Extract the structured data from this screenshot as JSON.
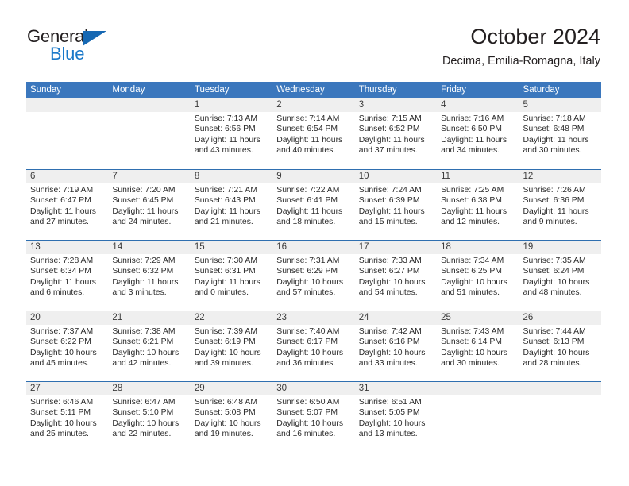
{
  "brand": {
    "name_part1": "General",
    "name_part2": "Blue",
    "triangle_color": "#1668b3",
    "blue_color": "#1b79c9"
  },
  "header": {
    "title": "October 2024",
    "location": "Decima, Emilia-Romagna, Italy",
    "accent_color": "#3b77bd",
    "band_color": "#efefef"
  },
  "weekdays": [
    "Sunday",
    "Monday",
    "Tuesday",
    "Wednesday",
    "Thursday",
    "Friday",
    "Saturday"
  ],
  "weeks": [
    [
      {
        "day": "",
        "lines": []
      },
      {
        "day": "",
        "lines": []
      },
      {
        "day": "1",
        "lines": [
          "Sunrise: 7:13 AM",
          "Sunset: 6:56 PM",
          "Daylight: 11 hours",
          "and 43 minutes."
        ]
      },
      {
        "day": "2",
        "lines": [
          "Sunrise: 7:14 AM",
          "Sunset: 6:54 PM",
          "Daylight: 11 hours",
          "and 40 minutes."
        ]
      },
      {
        "day": "3",
        "lines": [
          "Sunrise: 7:15 AM",
          "Sunset: 6:52 PM",
          "Daylight: 11 hours",
          "and 37 minutes."
        ]
      },
      {
        "day": "4",
        "lines": [
          "Sunrise: 7:16 AM",
          "Sunset: 6:50 PM",
          "Daylight: 11 hours",
          "and 34 minutes."
        ]
      },
      {
        "day": "5",
        "lines": [
          "Sunrise: 7:18 AM",
          "Sunset: 6:48 PM",
          "Daylight: 11 hours",
          "and 30 minutes."
        ]
      }
    ],
    [
      {
        "day": "6",
        "lines": [
          "Sunrise: 7:19 AM",
          "Sunset: 6:47 PM",
          "Daylight: 11 hours",
          "and 27 minutes."
        ]
      },
      {
        "day": "7",
        "lines": [
          "Sunrise: 7:20 AM",
          "Sunset: 6:45 PM",
          "Daylight: 11 hours",
          "and 24 minutes."
        ]
      },
      {
        "day": "8",
        "lines": [
          "Sunrise: 7:21 AM",
          "Sunset: 6:43 PM",
          "Daylight: 11 hours",
          "and 21 minutes."
        ]
      },
      {
        "day": "9",
        "lines": [
          "Sunrise: 7:22 AM",
          "Sunset: 6:41 PM",
          "Daylight: 11 hours",
          "and 18 minutes."
        ]
      },
      {
        "day": "10",
        "lines": [
          "Sunrise: 7:24 AM",
          "Sunset: 6:39 PM",
          "Daylight: 11 hours",
          "and 15 minutes."
        ]
      },
      {
        "day": "11",
        "lines": [
          "Sunrise: 7:25 AM",
          "Sunset: 6:38 PM",
          "Daylight: 11 hours",
          "and 12 minutes."
        ]
      },
      {
        "day": "12",
        "lines": [
          "Sunrise: 7:26 AM",
          "Sunset: 6:36 PM",
          "Daylight: 11 hours",
          "and 9 minutes."
        ]
      }
    ],
    [
      {
        "day": "13",
        "lines": [
          "Sunrise: 7:28 AM",
          "Sunset: 6:34 PM",
          "Daylight: 11 hours",
          "and 6 minutes."
        ]
      },
      {
        "day": "14",
        "lines": [
          "Sunrise: 7:29 AM",
          "Sunset: 6:32 PM",
          "Daylight: 11 hours",
          "and 3 minutes."
        ]
      },
      {
        "day": "15",
        "lines": [
          "Sunrise: 7:30 AM",
          "Sunset: 6:31 PM",
          "Daylight: 11 hours",
          "and 0 minutes."
        ]
      },
      {
        "day": "16",
        "lines": [
          "Sunrise: 7:31 AM",
          "Sunset: 6:29 PM",
          "Daylight: 10 hours",
          "and 57 minutes."
        ]
      },
      {
        "day": "17",
        "lines": [
          "Sunrise: 7:33 AM",
          "Sunset: 6:27 PM",
          "Daylight: 10 hours",
          "and 54 minutes."
        ]
      },
      {
        "day": "18",
        "lines": [
          "Sunrise: 7:34 AM",
          "Sunset: 6:25 PM",
          "Daylight: 10 hours",
          "and 51 minutes."
        ]
      },
      {
        "day": "19",
        "lines": [
          "Sunrise: 7:35 AM",
          "Sunset: 6:24 PM",
          "Daylight: 10 hours",
          "and 48 minutes."
        ]
      }
    ],
    [
      {
        "day": "20",
        "lines": [
          "Sunrise: 7:37 AM",
          "Sunset: 6:22 PM",
          "Daylight: 10 hours",
          "and 45 minutes."
        ]
      },
      {
        "day": "21",
        "lines": [
          "Sunrise: 7:38 AM",
          "Sunset: 6:21 PM",
          "Daylight: 10 hours",
          "and 42 minutes."
        ]
      },
      {
        "day": "22",
        "lines": [
          "Sunrise: 7:39 AM",
          "Sunset: 6:19 PM",
          "Daylight: 10 hours",
          "and 39 minutes."
        ]
      },
      {
        "day": "23",
        "lines": [
          "Sunrise: 7:40 AM",
          "Sunset: 6:17 PM",
          "Daylight: 10 hours",
          "and 36 minutes."
        ]
      },
      {
        "day": "24",
        "lines": [
          "Sunrise: 7:42 AM",
          "Sunset: 6:16 PM",
          "Daylight: 10 hours",
          "and 33 minutes."
        ]
      },
      {
        "day": "25",
        "lines": [
          "Sunrise: 7:43 AM",
          "Sunset: 6:14 PM",
          "Daylight: 10 hours",
          "and 30 minutes."
        ]
      },
      {
        "day": "26",
        "lines": [
          "Sunrise: 7:44 AM",
          "Sunset: 6:13 PM",
          "Daylight: 10 hours",
          "and 28 minutes."
        ]
      }
    ],
    [
      {
        "day": "27",
        "lines": [
          "Sunrise: 6:46 AM",
          "Sunset: 5:11 PM",
          "Daylight: 10 hours",
          "and 25 minutes."
        ]
      },
      {
        "day": "28",
        "lines": [
          "Sunrise: 6:47 AM",
          "Sunset: 5:10 PM",
          "Daylight: 10 hours",
          "and 22 minutes."
        ]
      },
      {
        "day": "29",
        "lines": [
          "Sunrise: 6:48 AM",
          "Sunset: 5:08 PM",
          "Daylight: 10 hours",
          "and 19 minutes."
        ]
      },
      {
        "day": "30",
        "lines": [
          "Sunrise: 6:50 AM",
          "Sunset: 5:07 PM",
          "Daylight: 10 hours",
          "and 16 minutes."
        ]
      },
      {
        "day": "31",
        "lines": [
          "Sunrise: 6:51 AM",
          "Sunset: 5:05 PM",
          "Daylight: 10 hours",
          "and 13 minutes."
        ]
      },
      {
        "day": "",
        "lines": []
      },
      {
        "day": "",
        "lines": []
      }
    ]
  ]
}
